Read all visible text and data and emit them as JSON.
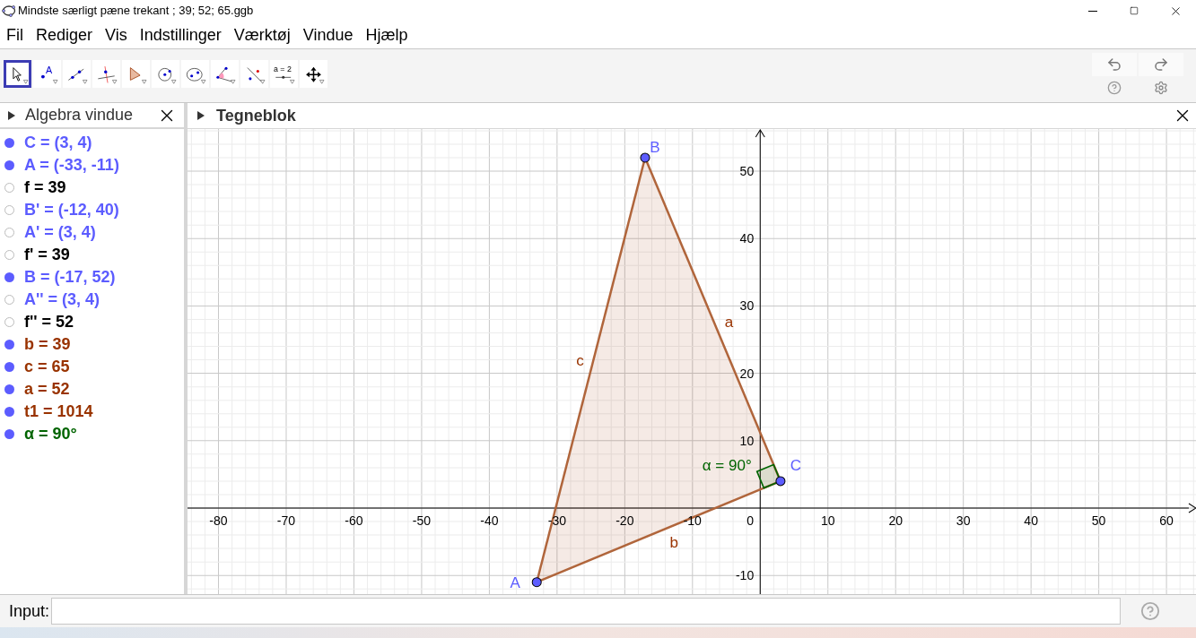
{
  "window": {
    "title": "Mindste særligt pæne trekant ; 39; 52; 65.ggb"
  },
  "menu": [
    "Fil",
    "Rediger",
    "Vis",
    "Indstillinger",
    "Værktøj",
    "Vindue",
    "Hjælp"
  ],
  "toolbar": [
    {
      "kind": "move",
      "selected": true
    },
    {
      "kind": "point",
      "label": "A",
      "selected": false
    },
    {
      "kind": "line",
      "selected": false
    },
    {
      "kind": "perpendicular",
      "selected": false
    },
    {
      "kind": "polygon",
      "selected": false
    },
    {
      "kind": "circle",
      "selected": false
    },
    {
      "kind": "ellipse",
      "selected": false
    },
    {
      "kind": "angle",
      "selected": false
    },
    {
      "kind": "reflect",
      "selected": false
    },
    {
      "kind": "slider",
      "label": "a = 2",
      "selected": false
    },
    {
      "kind": "pan",
      "selected": false
    }
  ],
  "algebra": {
    "title": "Algebra vindue",
    "items": [
      {
        "text": "C = (3, 4)",
        "visible": true,
        "color": "#5c5cff"
      },
      {
        "text": "A = (-33, -11)",
        "visible": true,
        "color": "#5c5cff"
      },
      {
        "text": "f = 39",
        "visible": false,
        "color": "#000000"
      },
      {
        "text": "B' = (-12, 40)",
        "visible": false,
        "color": "#5c5cff"
      },
      {
        "text": "A' = (3, 4)",
        "visible": false,
        "color": "#5c5cff"
      },
      {
        "text": "f' = 39",
        "visible": false,
        "color": "#000000"
      },
      {
        "text": "B = (-17, 52)",
        "visible": true,
        "color": "#5c5cff"
      },
      {
        "text": "A'' = (3, 4)",
        "visible": false,
        "color": "#5c5cff"
      },
      {
        "text": "f'' = 52",
        "visible": false,
        "color": "#000000"
      },
      {
        "text": "b = 39",
        "visible": true,
        "color": "#993300"
      },
      {
        "text": "c = 65",
        "visible": true,
        "color": "#993300"
      },
      {
        "text": "a = 52",
        "visible": true,
        "color": "#993300"
      },
      {
        "text": "t1 = 1014",
        "visible": true,
        "color": "#993300"
      },
      {
        "text": "α = 90°",
        "visible": true,
        "color": "#006400"
      }
    ]
  },
  "graphics": {
    "title": "Tegneblok",
    "x_ticks": [
      "-80",
      "-70",
      "-60",
      "-50",
      "-40",
      "-30",
      "-20",
      "-10",
      "0",
      "10",
      "20",
      "30",
      "40",
      "50",
      "60"
    ],
    "y_ticks": [
      "50",
      "40",
      "30",
      "20",
      "10",
      "-10"
    ],
    "points": [
      {
        "label": "A"
      },
      {
        "label": "B"
      },
      {
        "label": "C"
      }
    ],
    "segments": [
      {
        "label": "a"
      },
      {
        "label": "b"
      },
      {
        "label": "c"
      }
    ],
    "angle": {
      "label": "α = 90°"
    }
  },
  "input": {
    "label": "Input:"
  }
}
